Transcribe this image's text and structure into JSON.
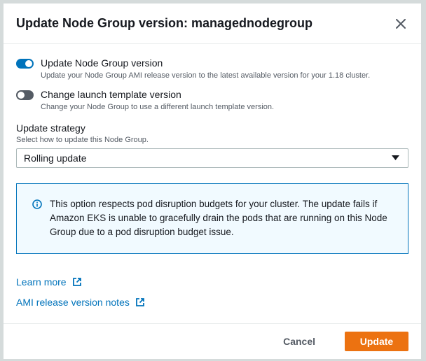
{
  "modal": {
    "title": "Update Node Group version: managednodegroup",
    "close_icon": "close-icon"
  },
  "options": {
    "update_version": {
      "label": "Update Node Group version",
      "description": "Update your Node Group AMI release version to the latest available version for your 1.18 cluster.",
      "enabled": true
    },
    "launch_template": {
      "label": "Change launch template version",
      "description": "Change your Node Group to use a different launch template version.",
      "enabled": false
    }
  },
  "strategy": {
    "label": "Update strategy",
    "description": "Select how to update this Node Group.",
    "selected": "Rolling update"
  },
  "info": {
    "icon": "info-icon",
    "text": "This option respects pod disruption budgets for your cluster. The update fails if Amazon EKS is unable to gracefully drain the pods that are running on this Node Group due to a pod disruption budget issue."
  },
  "links": {
    "learn_more": "Learn more",
    "ami_notes": "AMI release version notes"
  },
  "footer": {
    "cancel_label": "Cancel",
    "update_label": "Update"
  },
  "colors": {
    "accent": "#0073bb",
    "primary_button": "#ec7211",
    "toggle_off": "#545b64"
  }
}
